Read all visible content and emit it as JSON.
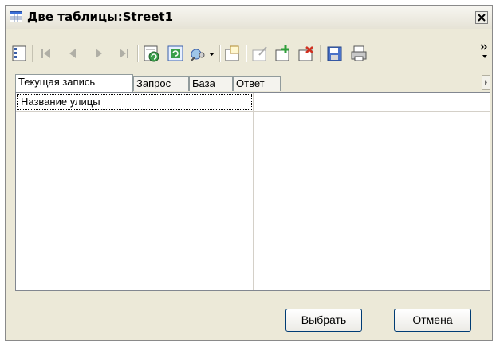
{
  "window": {
    "title": "Две таблицы:Street1"
  },
  "toolbar": {
    "items": [
      {
        "icon": "columns-icon"
      },
      {
        "icon": "first-record-icon"
      },
      {
        "icon": "prev-record-icon"
      },
      {
        "icon": "next-record-icon"
      },
      {
        "icon": "last-record-icon"
      },
      {
        "icon": "refresh-icon"
      },
      {
        "icon": "reload-icon"
      },
      {
        "icon": "search-icon"
      },
      {
        "icon": "new-record-icon"
      },
      {
        "icon": "edit-record-icon"
      },
      {
        "icon": "add-record-icon"
      },
      {
        "icon": "delete-record-icon"
      },
      {
        "icon": "save-icon"
      },
      {
        "icon": "print-icon"
      }
    ]
  },
  "tabs": [
    {
      "label": "Текущая запись"
    },
    {
      "label": "Запрос"
    },
    {
      "label": "База"
    },
    {
      "label": "Ответ"
    }
  ],
  "grid": {
    "rows": [
      {
        "field": "Название улицы",
        "value": ""
      }
    ]
  },
  "buttons": {
    "select": "Выбрать",
    "cancel": "Отмена"
  }
}
